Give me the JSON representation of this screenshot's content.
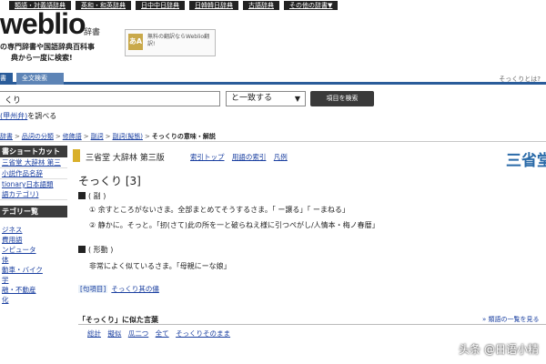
{
  "top_nav": [
    "類語・対義語辞典",
    "英和・和英辞典",
    "日中中日辞典",
    "日韓韓日辞典",
    "古語辞典",
    "その他の辞書▼"
  ],
  "logo": {
    "text": "weblio",
    "sub": "辞書"
  },
  "tagline": [
    "の専門辞書や国語辞典百科事",
    "典から一度に検索!"
  ],
  "translate_box": {
    "icon": "あA",
    "text": "無料の翻訳ならWeblio翻訳!"
  },
  "about_link": "そっくりとは?",
  "search_tabs": [
    "書",
    "全文検索"
  ],
  "search": {
    "value": "くり",
    "mode": "と一致する",
    "button": "項目を検索"
  },
  "suggest": {
    "link": "(甲州弁)",
    "rest": "を調べる"
  },
  "breadcrumb": [
    "辞書",
    "品詞の分類",
    "修飾語",
    "副詞",
    "副詞(擬態)",
    "そっくりの意味・解説"
  ],
  "sidebar": {
    "shortcut_heading": "書ショートカット",
    "shortcut_items": [
      "三省堂 大辞林 第三",
      "小説作品名辞",
      "tionary日本語類",
      "語カテゴリ)"
    ],
    "category_heading": "テゴリー覧",
    "category_items": [
      "ジネス",
      "費用語",
      "ンピュータ",
      "体",
      "動車・バイク",
      "",
      "学",
      "融・不動産",
      "化"
    ]
  },
  "main": {
    "dict_title": "三省堂 大辞林 第三版",
    "dict_links": [
      "索引トップ",
      "用語の索引",
      "凡例"
    ],
    "dict_right": "三省堂",
    "headword": "そっくり [3]",
    "section1": "( 副 )",
    "def1": "① 余すところがないさま。全部まとめてそうするさま。「 ー譲る」「 ーまねる」",
    "def2": "② 静かに。そっと。「扨(さて)此の所を一と破らねえ様に引つぺがし/人情本・梅ノ春暦」",
    "section2": "( 形動 )",
    "def3": "非常によく似ているさま。「母親にーな娘」",
    "related_label": "[句項目]",
    "related_text": "そっくり其の儘",
    "similar_heading": "「そっくり」に似た言葉",
    "similar_more": "» 類語の一覧を見る",
    "similar_links": [
      "総計",
      "擬似",
      "瓜二つ",
      "全て",
      "そっくりそのまま"
    ]
  },
  "watermark": "头条 @日语小精"
}
